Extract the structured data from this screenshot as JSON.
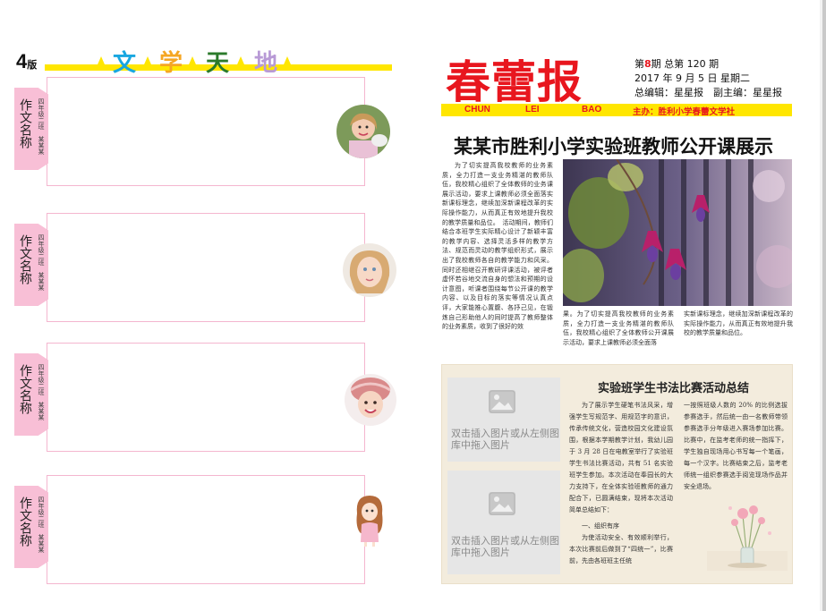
{
  "left_page": {
    "page_number": "4",
    "page_suffix": "版",
    "column_title_chars": [
      "文",
      "学",
      "天",
      "地"
    ],
    "column_title_colors": [
      "#19a7e0",
      "#f5a623",
      "#2b7a2b",
      "#b89ad6"
    ],
    "entries": [
      {
        "title": "作文名称",
        "byline": "四年级二班　某某某"
      },
      {
        "title": "作文名称",
        "byline": "四年级二班　某某某"
      },
      {
        "title": "作文名称",
        "byline": "四年级二班　某某某"
      },
      {
        "title": "作文名称",
        "byline": "四年级二班　某某某"
      }
    ]
  },
  "masthead": {
    "title": "春蕾报",
    "issue_prefix": "第",
    "issue_number": "8",
    "issue_suffix": "期 总第 120 期",
    "date": "2017 年 9 月 5 日 星期二",
    "editors": "总编辑：星星报　副主编：星星报",
    "bar_words": [
      "CHUN",
      "LEI",
      "BAO"
    ],
    "sponsor": "主办：胜利小学春蕾文学社",
    "title_color": "#e8161e",
    "bar_color": "#ffe600"
  },
  "article1": {
    "headline": "某某市胜利小学实验班教师公开课展示",
    "col1": "为了切实提高我校教师的业务素质，全力打造一支业务精湛的教师队伍，我校精心组织了全体教师的业务课展示活动，要求上课教师必须全面落实新课标理念，继续加深新课程改革的实际操作能力，从而真正有效地提升我校的教学质量和品位。　活动期间，教师们结合本班学生实际精心设计了新颖丰富的教学内容、选择灵活多样的教学方法、规范而灵动的教学组织形式，展示出了我校教师各自的教学能力和风采。同时还相继召开教研评课活动，被评者虚怀若谷地交流自身的想法和预期的设计意图，听课者围绕每节公开课的教学内容、以及目标的落实等情况认真点评，大家能推心置腹、各抒己见，在锻炼自己形助他人的同时提高了教师整体的业务素质，收到了很好的效",
    "col2": "果。为了切实提高我校教师的业务素质，全力打造一支业务精湛的教师队伍，我校精心组织了全体教师公开课展示活动，要求上课教师必须全面落",
    "col3": "实新课标理念，继续加深新课程改革的实际操作能力，从而真正有效地提升我校的教学质量和品位。"
  },
  "article2": {
    "headline": "实验班学生书法比赛活动总结",
    "placeholder_1": "双击插入图片或从左侧图库中拖入图片",
    "placeholder_2": "双击插入图片或从左侧图库中拖入图片",
    "col1": "为了展示学生硬笔书法风采，增强学生写规范字、用规范字的意识，传承传统文化，营造校园文化建设氛围，根据本学期教学计划，我幼儿园于 3 月 28 日在电教室举行了实验班学生书法比赛活动，共有 51 名实验班学生参加。本次活动在奉园长的大力支持下，在全体实验班教师的通力配合下，已圆满结束，现将本次活动简单总结如下：",
    "subhead": "一、组织有序",
    "col1b": "为使活动安全、有效顺利举行，本次比赛前后做到了“四统一”，比赛前，先由各班班主任统",
    "col2": "一按照班级人数的 20% 的比例选拔参赛选手，然后统一由一名教师带领参赛选手分年级进入赛场参加比赛。比赛中，在监考老师的统一指挥下，学生独自现场用心书写每一个笔画，每一个汉字。比赛结束之后，监考老师统一组织参赛选手阅览现场作品并安全退场。"
  }
}
